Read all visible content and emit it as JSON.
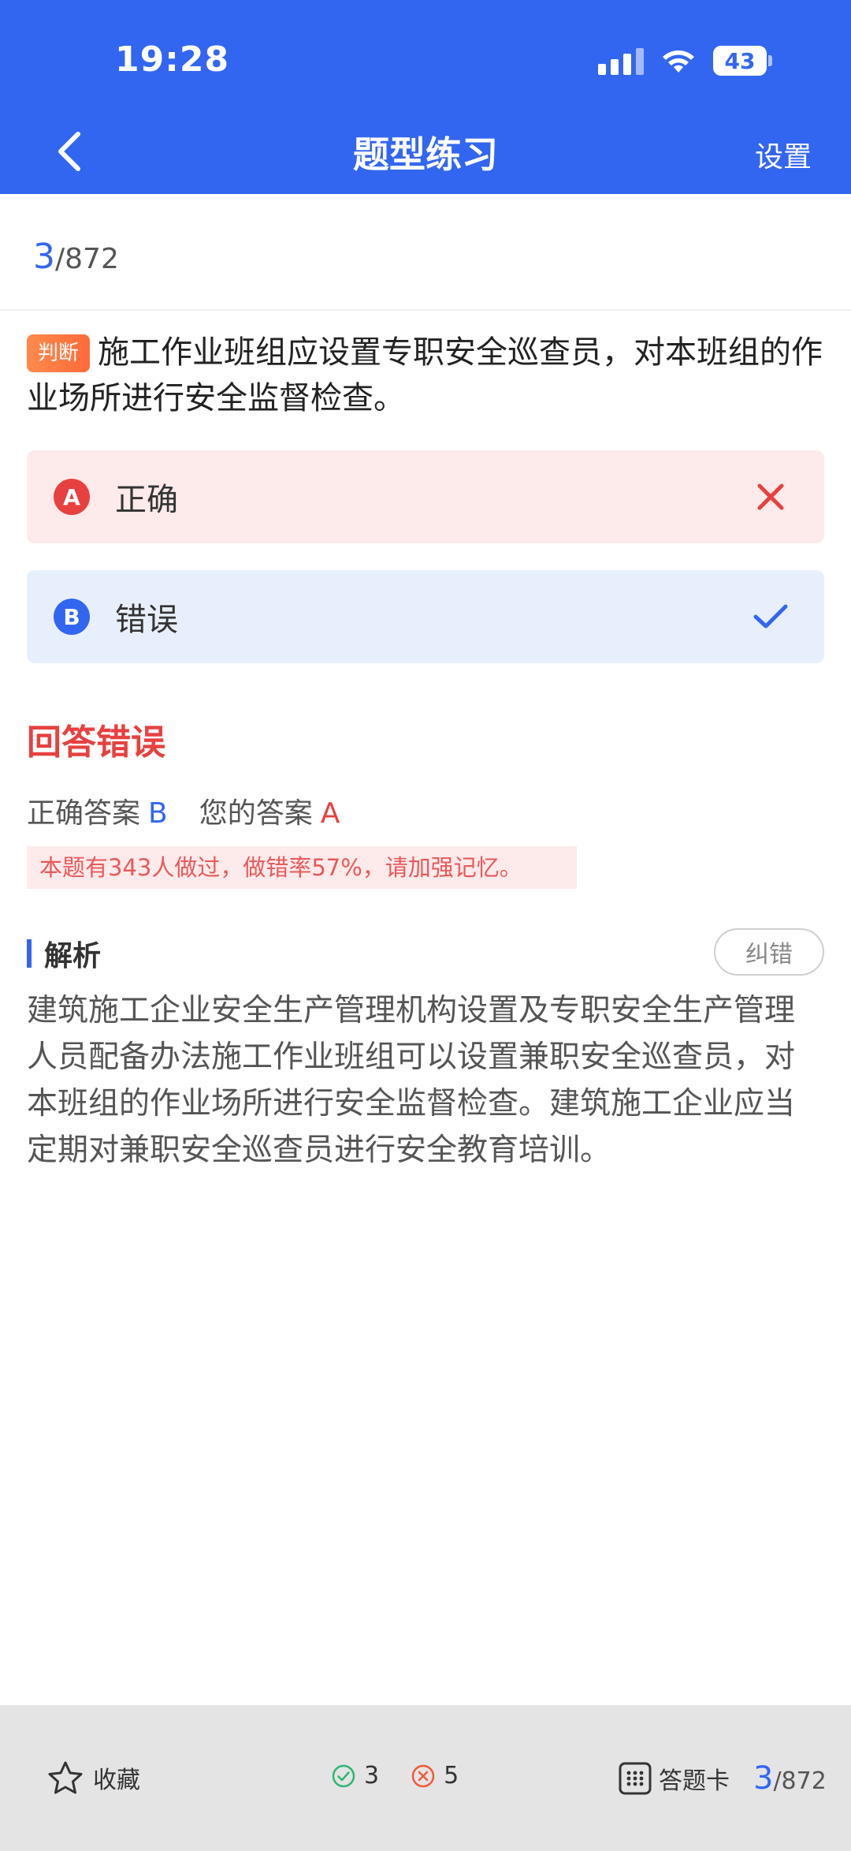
{
  "status": {
    "time": "19:28",
    "battery": "43"
  },
  "nav": {
    "title": "题型练习",
    "settings": "设置"
  },
  "progress": {
    "current": "3",
    "total": "/872"
  },
  "question": {
    "type": "判断",
    "text": "施工作业班组应设置专职安全巡查员，对本班组的作业场所进行安全监督检查。"
  },
  "options": [
    {
      "letter": "A",
      "text": "正确"
    },
    {
      "letter": "B",
      "text": "错误"
    }
  ],
  "result": {
    "title": "回答错误",
    "correct_label": "正确答案",
    "correct_value": "B",
    "yours_label": "您的答案",
    "yours_value": "A",
    "note": "本题有343人做过，做错率57%，请加强记忆。"
  },
  "analysis": {
    "title": "解析",
    "report_button": "纠错",
    "text": "建筑施工企业安全生产管理机构设置及专职安全生产管理人员配备办法施工作业班组可以设置兼职安全巡查员，对本班组的作业场所进行安全监督检查。建筑施工企业应当定期对兼职安全巡查员进行安全教育培训。"
  },
  "bottom": {
    "favorite": "收藏",
    "correct_count": "3",
    "wrong_count": "5",
    "answer_card": "答题卡",
    "progress_current": "3",
    "progress_total": "/872"
  },
  "colors": {
    "brand": "#3366f0",
    "error": "#e84040",
    "type_tag": "#ff7a40"
  }
}
